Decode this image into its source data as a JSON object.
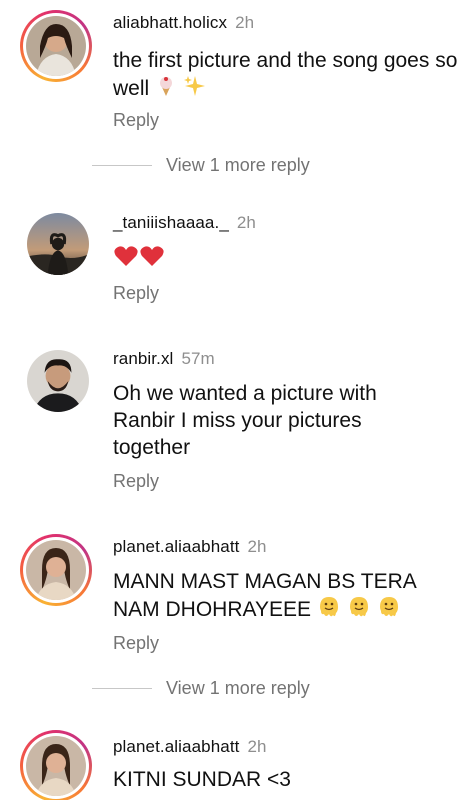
{
  "comments": [
    {
      "username": "aliabhatt.holicx",
      "time": "2h",
      "text": "the first picture and the song goes so well",
      "reply_label": "Reply",
      "more_replies": "View 1 more reply"
    },
    {
      "username": "_taniiishaaaa._",
      "time": "2h",
      "text": "",
      "reply_label": "Reply"
    },
    {
      "username": "ranbir.xl",
      "time": "57m",
      "text": "Oh we wanted a picture with Ranbir I miss your pictures together",
      "reply_label": "Reply"
    },
    {
      "username": "planet.aliaabhatt",
      "time": "2h",
      "text": "MANN MAST MAGAN BS TERA NAM DHOHRAYEEE",
      "reply_label": "Reply",
      "more_replies": "View 1 more reply"
    },
    {
      "username": "planet.aliaabhatt",
      "time": "2h",
      "text": "KITNI SUNDAR <3"
    }
  ],
  "colors": {
    "secondary_text": "#737373",
    "heart": "#e0313b"
  },
  "icons": [
    "ice-cream-icon",
    "sparkles-icon",
    "red-heart-icon",
    "melting-face-icon"
  ]
}
